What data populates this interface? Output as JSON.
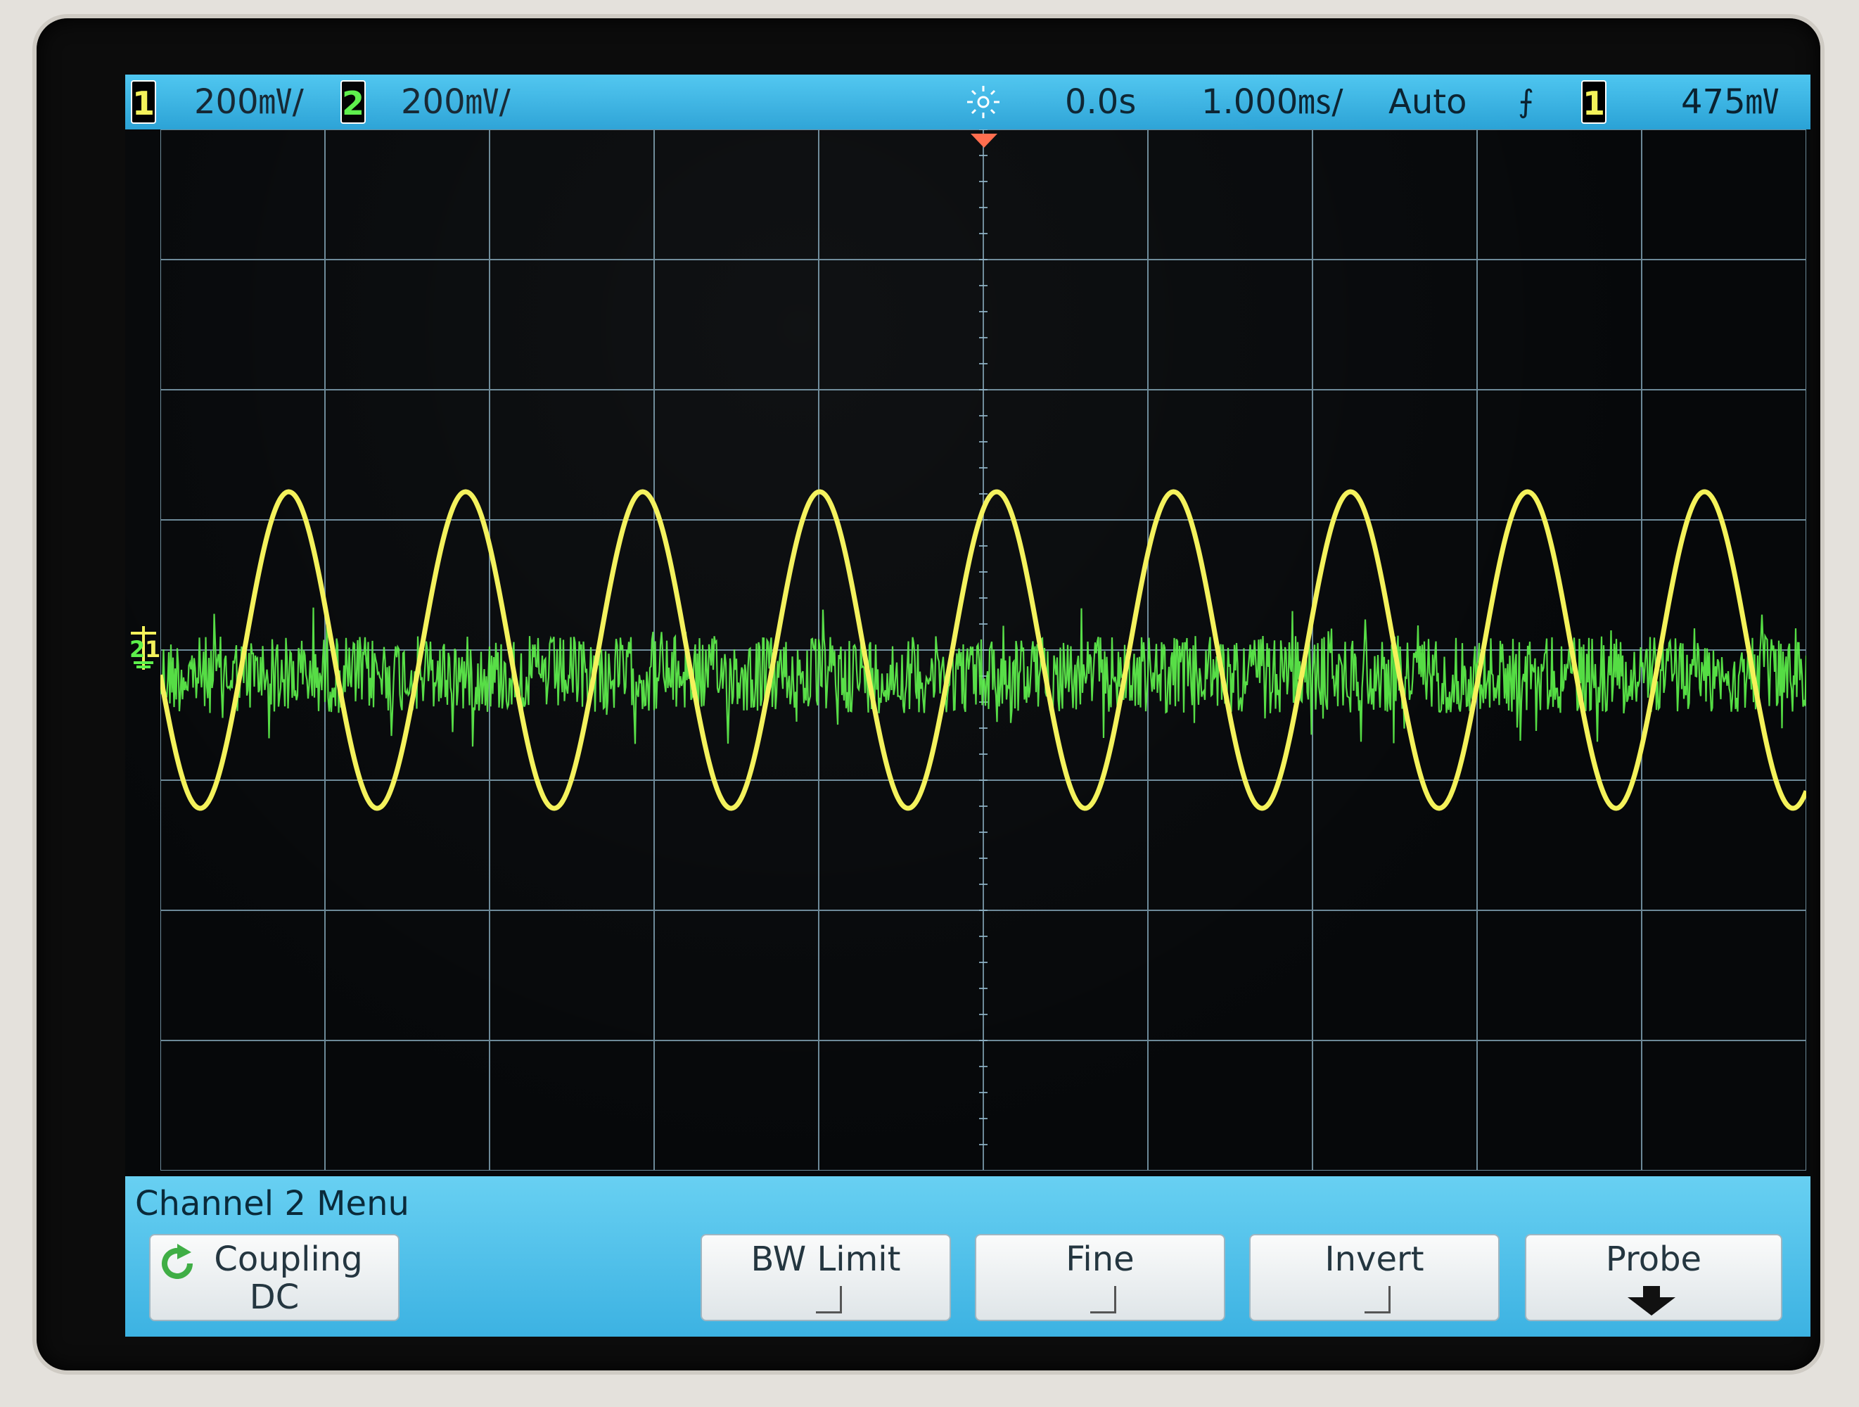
{
  "status_bar": {
    "ch1_label": "1",
    "ch1_scale": "200㎷/",
    "ch2_label": "2",
    "ch2_scale": "200㎷/",
    "time_position": "0.0s",
    "time_scale": "1.000㎳/",
    "trigger_mode": "Auto",
    "trigger_slope_symbol": "⨍",
    "trigger_source": "1",
    "trigger_level": "475㎷",
    "run_icon": "acquisition-sun-icon"
  },
  "markers": {
    "ch2_ground_label": "2",
    "ch1_ground_label": "1"
  },
  "waveforms": {
    "ch1": {
      "type": "sine",
      "color": "#f4f25a",
      "cycles_visible": 9.3
    },
    "ch2": {
      "type": "noise",
      "color": "#5cf04a"
    }
  },
  "menu": {
    "title": "Channel 2  Menu",
    "softkeys": [
      {
        "label": "Coupling",
        "value": "DC",
        "icon": "cycle-arrow-icon"
      },
      {
        "label": "BW Limit",
        "value": ""
      },
      {
        "label": "Fine",
        "value": ""
      },
      {
        "label": "Invert",
        "value": ""
      },
      {
        "label": "Probe",
        "value": "",
        "icon": "down-arrow-icon"
      }
    ]
  },
  "colors": {
    "status_bar": "#3bb4e4",
    "grid": "#8fb4c8",
    "ch1": "#f4f25a",
    "ch2": "#5cf04a"
  }
}
